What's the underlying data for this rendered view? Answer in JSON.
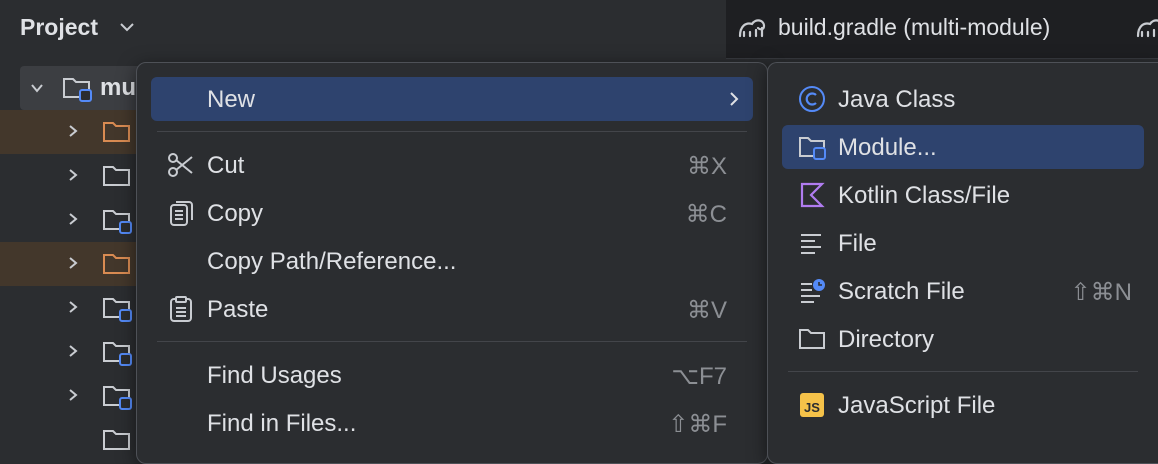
{
  "project_panel": {
    "title": "Project",
    "root_label": "mu"
  },
  "editor": {
    "tab_label": "build.gradle (multi-module)"
  },
  "context_menu": {
    "new_label": "New",
    "cut_label": "Cut",
    "cut_shortcut": "⌘X",
    "copy_label": "Copy",
    "copy_shortcut": "⌘C",
    "copy_path_label": "Copy Path/Reference...",
    "paste_label": "Paste",
    "paste_shortcut": "⌘V",
    "find_usages_label": "Find Usages",
    "find_usages_shortcut": "⌥F7",
    "find_in_files_label": "Find in Files...",
    "find_in_files_shortcut": "⇧⌘F"
  },
  "new_submenu": {
    "java_class": "Java Class",
    "module": "Module...",
    "kotlin_class": "Kotlin Class/File",
    "file": "File",
    "scratch_file": "Scratch File",
    "scratch_shortcut": "⇧⌘N",
    "directory": "Directory",
    "javascript_file": "JavaScript File"
  },
  "colors": {
    "panel_bg": "#2b2d30",
    "selection": "#2e436e",
    "highlight_row": "#43372b",
    "java_icon": "#548af7",
    "kotlin_icon": "#b07cf0",
    "js_icon": "#f5c249"
  }
}
